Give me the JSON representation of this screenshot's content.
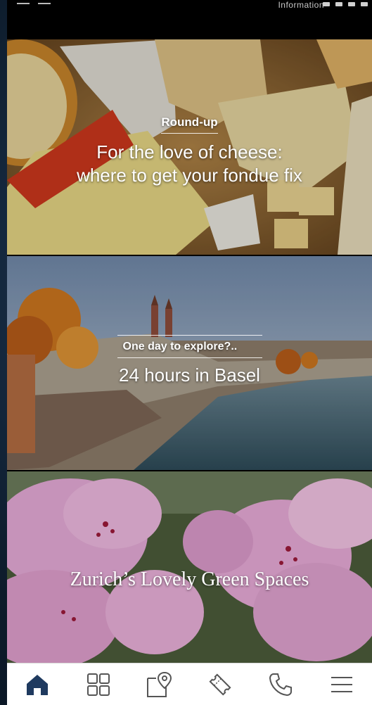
{
  "header": {
    "info_label": "Information"
  },
  "cards": [
    {
      "kicker": "Round-up",
      "headline_line1": "For the love of cheese:",
      "headline_line2": "where to get your fondue fix"
    },
    {
      "kicker": "One day to explore?..",
      "headline": "24 hours in Basel"
    },
    {
      "headline": "Zurich’s Lovely Green Spaces"
    }
  ],
  "bottom_nav": {
    "items": [
      {
        "icon": "home-icon",
        "active": true
      },
      {
        "icon": "grid-icon",
        "active": false
      },
      {
        "icon": "map-pin-icon",
        "active": false
      },
      {
        "icon": "ticket-icon",
        "active": false
      },
      {
        "icon": "phone-icon",
        "active": false
      },
      {
        "icon": "menu-icon",
        "active": false
      }
    ]
  },
  "colors": {
    "active_icon": "#1f3a5f",
    "inactive_icon": "#555555",
    "nav_background": "#ffffff"
  }
}
